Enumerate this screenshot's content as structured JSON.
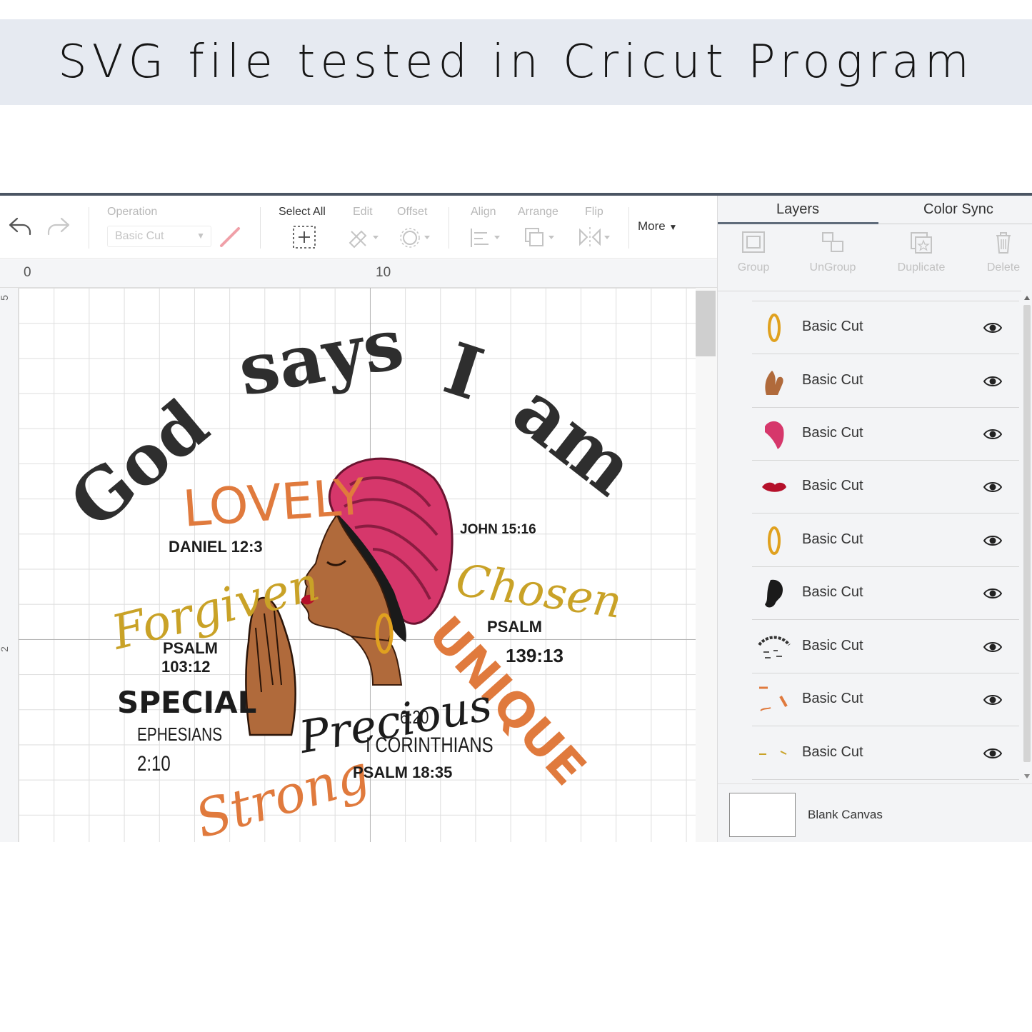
{
  "banner": {
    "title": "SVG file tested in Cricut Program"
  },
  "toolbar": {
    "operation_label": "Operation",
    "operation_value": "Basic Cut",
    "select_all": "Select All",
    "edit": "Edit",
    "offset": "Offset",
    "align": "Align",
    "arrange": "Arrange",
    "flip": "Flip",
    "more": "More"
  },
  "ruler": {
    "top_marks": [
      "0",
      "10"
    ],
    "left_marks": [
      "5",
      "2"
    ]
  },
  "design": {
    "arc_words": [
      "God",
      "says",
      "I",
      "am"
    ],
    "words": {
      "lovely": "LOVELY",
      "forgiven": "Forgiven",
      "chosen": "Chosen",
      "unique": "UNIQUE",
      "special": "SPECIAL",
      "precious": "Precious",
      "strong": "Strong"
    },
    "refs": {
      "daniel": "DANIEL 12:3",
      "john": "JOHN 15:16",
      "psalm1": "PSALM",
      "psalm1_num": "103:12",
      "psalm2": "PSALM",
      "psalm2_num": "139:13",
      "ephesians": "EPHESIANS",
      "ephesians_num": "2:10",
      "cor_num": "6:20",
      "corinthians": "I CORINTHIANS",
      "psalm3": "PSALM 18:35"
    }
  },
  "panel": {
    "tabs": [
      "Layers",
      "Color Sync"
    ],
    "tools": [
      "Group",
      "UnGroup",
      "Duplicate",
      "Delete"
    ],
    "layers": [
      {
        "name": "Basic Cut",
        "thumb": "gold-hoop-earring"
      },
      {
        "name": "Basic Cut",
        "thumb": "praying-hands"
      },
      {
        "name": "Basic Cut",
        "thumb": "pink-headwrap"
      },
      {
        "name": "Basic Cut",
        "thumb": "red-lips"
      },
      {
        "name": "Basic Cut",
        "thumb": "gold-hoop-earring"
      },
      {
        "name": "Basic Cut",
        "thumb": "hair-silhouette"
      },
      {
        "name": "Basic Cut",
        "thumb": "black-text-group"
      },
      {
        "name": "Basic Cut",
        "thumb": "orange-text-group"
      },
      {
        "name": "Basic Cut",
        "thumb": "gold-text-group"
      }
    ],
    "blank_canvas": "Blank Canvas"
  },
  "colors": {
    "banner_bg": "#e6eaf1",
    "headwrap": "#d6376b",
    "skin": "#b06a3b",
    "orange_words": "#e07a3d",
    "gold_words": "#c9a227",
    "dark_text": "#2e2e2e"
  }
}
